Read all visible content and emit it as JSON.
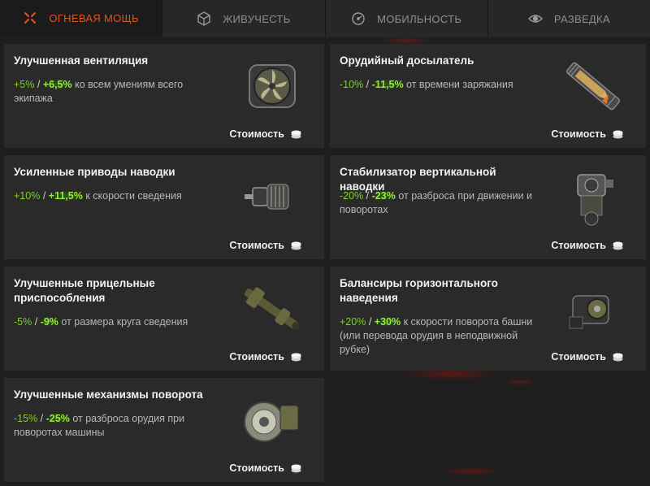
{
  "tabs": [
    {
      "label": "ОГНЕВАЯ МОЩЬ",
      "icon": "firepower-icon",
      "active": true
    },
    {
      "label": "ЖИВУЧЕСТЬ",
      "icon": "survivability-icon",
      "active": false
    },
    {
      "label": "МОБИЛЬНОСТЬ",
      "icon": "mobility-icon",
      "active": false
    },
    {
      "label": "РАЗВЕДКА",
      "icon": "eye-icon",
      "active": false
    }
  ],
  "cost_label": "Стоимость",
  "cards": [
    {
      "title": "Улучшенная вентиляция",
      "bonus_base": "+5%",
      "separator": "/",
      "bonus_plus": "+6,5%",
      "text": "ко всем умениям всего экипажа",
      "icon": "ventilation-icon"
    },
    {
      "title": "Орудийный досылатель",
      "bonus_base": "-10%",
      "separator": "/",
      "bonus_plus": "-11,5%",
      "text": "от времени заряжания",
      "icon": "rammer-icon"
    },
    {
      "title": "Усиленные приводы наводки",
      "bonus_base": "+10%",
      "separator": "/",
      "bonus_plus": "+11,5%",
      "text": "к скорости сведения",
      "icon": "aiming-drive-icon"
    },
    {
      "title": "Стабилизатор вертикальной наводки",
      "bonus_base": "-20%",
      "separator": "/",
      "bonus_plus": "-23%",
      "text": "от разброса при движении и поворотах",
      "icon": "stabilizer-icon"
    },
    {
      "title": "Улучшенные прицельные приспособления",
      "bonus_base": "-5%",
      "separator": "/",
      "bonus_plus": "-9%",
      "text": "от размера круга сведения",
      "icon": "sights-icon"
    },
    {
      "title": "Балансиры горизонтального наведения",
      "bonus_base": "+20%",
      "separator": "/",
      "bonus_plus": "+30%",
      "text": "к скорости поворота башни (или перевода орудия в неподвижной рубке)",
      "icon": "traverse-balancer-icon"
    },
    {
      "title": "Улучшенные механизмы поворота",
      "bonus_base": "-15%",
      "separator": "/",
      "bonus_plus": "-25%",
      "text": "от разброса орудия при поворотах машины",
      "icon": "rotation-mechanism-icon"
    }
  ]
}
